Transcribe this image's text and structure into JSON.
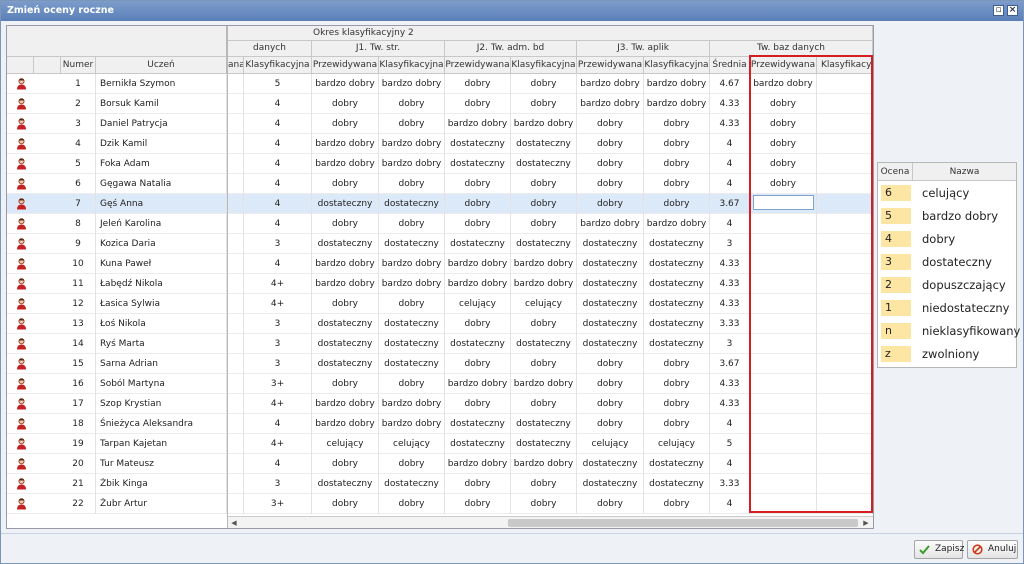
{
  "window": {
    "title": "Zmień oceny roczne"
  },
  "header": {
    "period": "Okres klasyfikacyjny 2",
    "group_partial": "danych",
    "groups": [
      "J1. Tw. str.",
      "J2. Tw. adm. bd",
      "J3. Tw. aplik",
      "Tw. baz danych"
    ],
    "col_numer": "Numer",
    "col_uczen": "Uczeń",
    "col_partial": "ana",
    "col_klasyfikacyjna": "Klasyfikacyjna",
    "col_przewidywana": "Przewidywana",
    "col_srednia": "Średnia",
    "col_klasyfikacyjna_partial": "Klasyfikacyjn"
  },
  "rows": [
    {
      "nr": "1",
      "name": "Bernikła Szymon",
      "k0": "5",
      "j1p": "bardzo dobry",
      "j1k": "bardzo dobry",
      "j2p": "dobry",
      "j2k": "dobry",
      "j3p": "bardzo dobry",
      "j3k": "bardzo dobry",
      "avg": "4.67",
      "tp": "bardzo dobry"
    },
    {
      "nr": "2",
      "name": "Borsuk Kamil",
      "k0": "4",
      "j1p": "dobry",
      "j1k": "dobry",
      "j2p": "dobry",
      "j2k": "dobry",
      "j3p": "bardzo dobry",
      "j3k": "bardzo dobry",
      "avg": "4.33",
      "tp": "dobry"
    },
    {
      "nr": "3",
      "name": "Daniel Patrycja",
      "k0": "4",
      "j1p": "dobry",
      "j1k": "dobry",
      "j2p": "bardzo dobry",
      "j2k": "bardzo dobry",
      "j3p": "dobry",
      "j3k": "dobry",
      "avg": "4.33",
      "tp": "dobry"
    },
    {
      "nr": "4",
      "name": "Dzik Kamil",
      "k0": "4",
      "j1p": "bardzo dobry",
      "j1k": "bardzo dobry",
      "j2p": "dostateczny",
      "j2k": "dostateczny",
      "j3p": "dobry",
      "j3k": "dobry",
      "avg": "4",
      "tp": "dobry"
    },
    {
      "nr": "5",
      "name": "Foka Adam",
      "k0": "4",
      "j1p": "bardzo dobry",
      "j1k": "bardzo dobry",
      "j2p": "dostateczny",
      "j2k": "dostateczny",
      "j3p": "dobry",
      "j3k": "dobry",
      "avg": "4",
      "tp": "dobry"
    },
    {
      "nr": "6",
      "name": "Gęgawa Natalia",
      "k0": "4",
      "j1p": "dobry",
      "j1k": "dobry",
      "j2p": "dobry",
      "j2k": "dobry",
      "j3p": "dobry",
      "j3k": "dobry",
      "avg": "4",
      "tp": "dobry"
    },
    {
      "nr": "7",
      "name": "Gęś Anna",
      "k0": "4",
      "j1p": "dostateczny",
      "j1k": "dostateczny",
      "j2p": "dobry",
      "j2k": "dobry",
      "j3p": "dobry",
      "j3k": "dobry",
      "avg": "3.67",
      "tp": ""
    },
    {
      "nr": "8",
      "name": "Jeleń Karolina",
      "k0": "4",
      "j1p": "dobry",
      "j1k": "dobry",
      "j2p": "dobry",
      "j2k": "dobry",
      "j3p": "bardzo dobry",
      "j3k": "bardzo dobry",
      "avg": "4",
      "tp": ""
    },
    {
      "nr": "9",
      "name": "Kozica Daria",
      "k0": "3",
      "j1p": "dostateczny",
      "j1k": "dostateczny",
      "j2p": "dostateczny",
      "j2k": "dostateczny",
      "j3p": "dostateczny",
      "j3k": "dostateczny",
      "avg": "3",
      "tp": ""
    },
    {
      "nr": "10",
      "name": "Kuna Paweł",
      "k0": "4",
      "j1p": "bardzo dobry",
      "j1k": "bardzo dobry",
      "j2p": "bardzo dobry",
      "j2k": "bardzo dobry",
      "j3p": "dostateczny",
      "j3k": "dostateczny",
      "avg": "4.33",
      "tp": ""
    },
    {
      "nr": "11",
      "name": "Łabędź Nikola",
      "k0": "4+",
      "j1p": "bardzo dobry",
      "j1k": "bardzo dobry",
      "j2p": "bardzo dobry",
      "j2k": "bardzo dobry",
      "j3p": "dostateczny",
      "j3k": "dostateczny",
      "avg": "4.33",
      "tp": ""
    },
    {
      "nr": "12",
      "name": "Łasica Sylwia",
      "k0": "4+",
      "j1p": "dobry",
      "j1k": "dobry",
      "j2p": "celujący",
      "j2k": "celujący",
      "j3p": "dostateczny",
      "j3k": "dostateczny",
      "avg": "4.33",
      "tp": ""
    },
    {
      "nr": "13",
      "name": "Łoś Nikola",
      "k0": "3",
      "j1p": "dostateczny",
      "j1k": "dostateczny",
      "j2p": "dobry",
      "j2k": "dobry",
      "j3p": "dostateczny",
      "j3k": "dostateczny",
      "avg": "3.33",
      "tp": ""
    },
    {
      "nr": "14",
      "name": "Ryś Marta",
      "k0": "3",
      "j1p": "dostateczny",
      "j1k": "dostateczny",
      "j2p": "dostateczny",
      "j2k": "dostateczny",
      "j3p": "dostateczny",
      "j3k": "dostateczny",
      "avg": "3",
      "tp": ""
    },
    {
      "nr": "15",
      "name": "Sarna Adrian",
      "k0": "3",
      "j1p": "dostateczny",
      "j1k": "dostateczny",
      "j2p": "dobry",
      "j2k": "dobry",
      "j3p": "dobry",
      "j3k": "dobry",
      "avg": "3.67",
      "tp": ""
    },
    {
      "nr": "16",
      "name": "Soból Martyna",
      "k0": "3+",
      "j1p": "dobry",
      "j1k": "dobry",
      "j2p": "bardzo dobry",
      "j2k": "bardzo dobry",
      "j3p": "dobry",
      "j3k": "dobry",
      "avg": "4.33",
      "tp": ""
    },
    {
      "nr": "17",
      "name": "Szop Krystian",
      "k0": "4+",
      "j1p": "bardzo dobry",
      "j1k": "bardzo dobry",
      "j2p": "dobry",
      "j2k": "dobry",
      "j3p": "dobry",
      "j3k": "dobry",
      "avg": "4.33",
      "tp": ""
    },
    {
      "nr": "18",
      "name": "Śnieżyca Aleksandra",
      "k0": "4",
      "j1p": "bardzo dobry",
      "j1k": "bardzo dobry",
      "j2p": "dostateczny",
      "j2k": "dostateczny",
      "j3p": "dobry",
      "j3k": "dobry",
      "avg": "4",
      "tp": ""
    },
    {
      "nr": "19",
      "name": "Tarpan Kajetan",
      "k0": "4+",
      "j1p": "celujący",
      "j1k": "celujący",
      "j2p": "dostateczny",
      "j2k": "dostateczny",
      "j3p": "celujący",
      "j3k": "celujący",
      "avg": "5",
      "tp": ""
    },
    {
      "nr": "20",
      "name": "Tur Mateusz",
      "k0": "4",
      "j1p": "dobry",
      "j1k": "dobry",
      "j2p": "bardzo dobry",
      "j2k": "bardzo dobry",
      "j3p": "dostateczny",
      "j3k": "dostateczny",
      "avg": "4",
      "tp": ""
    },
    {
      "nr": "21",
      "name": "Żbik Kinga",
      "k0": "3",
      "j1p": "dostateczny",
      "j1k": "dostateczny",
      "j2p": "dobry",
      "j2k": "dobry",
      "j3p": "dostateczny",
      "j3k": "dostateczny",
      "avg": "3.33",
      "tp": ""
    },
    {
      "nr": "22",
      "name": "Żubr Artur",
      "k0": "3+",
      "j1p": "dobry",
      "j1k": "dobry",
      "j2p": "dobry",
      "j2k": "dobry",
      "j3p": "dobry",
      "j3k": "dobry",
      "avg": "4",
      "tp": ""
    }
  ],
  "legend": {
    "col_ocena": "Ocena",
    "col_nazwa": "Nazwa",
    "items": [
      {
        "code": "6",
        "name": "celujący"
      },
      {
        "code": "5",
        "name": "bardzo dobry"
      },
      {
        "code": "4",
        "name": "dobry"
      },
      {
        "code": "3",
        "name": "dostateczny"
      },
      {
        "code": "2",
        "name": "dopuszczający"
      },
      {
        "code": "1",
        "name": "niedostateczny"
      },
      {
        "code": "n",
        "name": "nieklasyfikowany"
      },
      {
        "code": "z",
        "name": "zwolniony"
      }
    ]
  },
  "buttons": {
    "save": "Zapisz",
    "cancel": "Anuluj"
  },
  "colors": {
    "accent_red": "#d51d24",
    "legend_code_bg": "#fde6a4",
    "selected_row": "#dbe9f8"
  }
}
